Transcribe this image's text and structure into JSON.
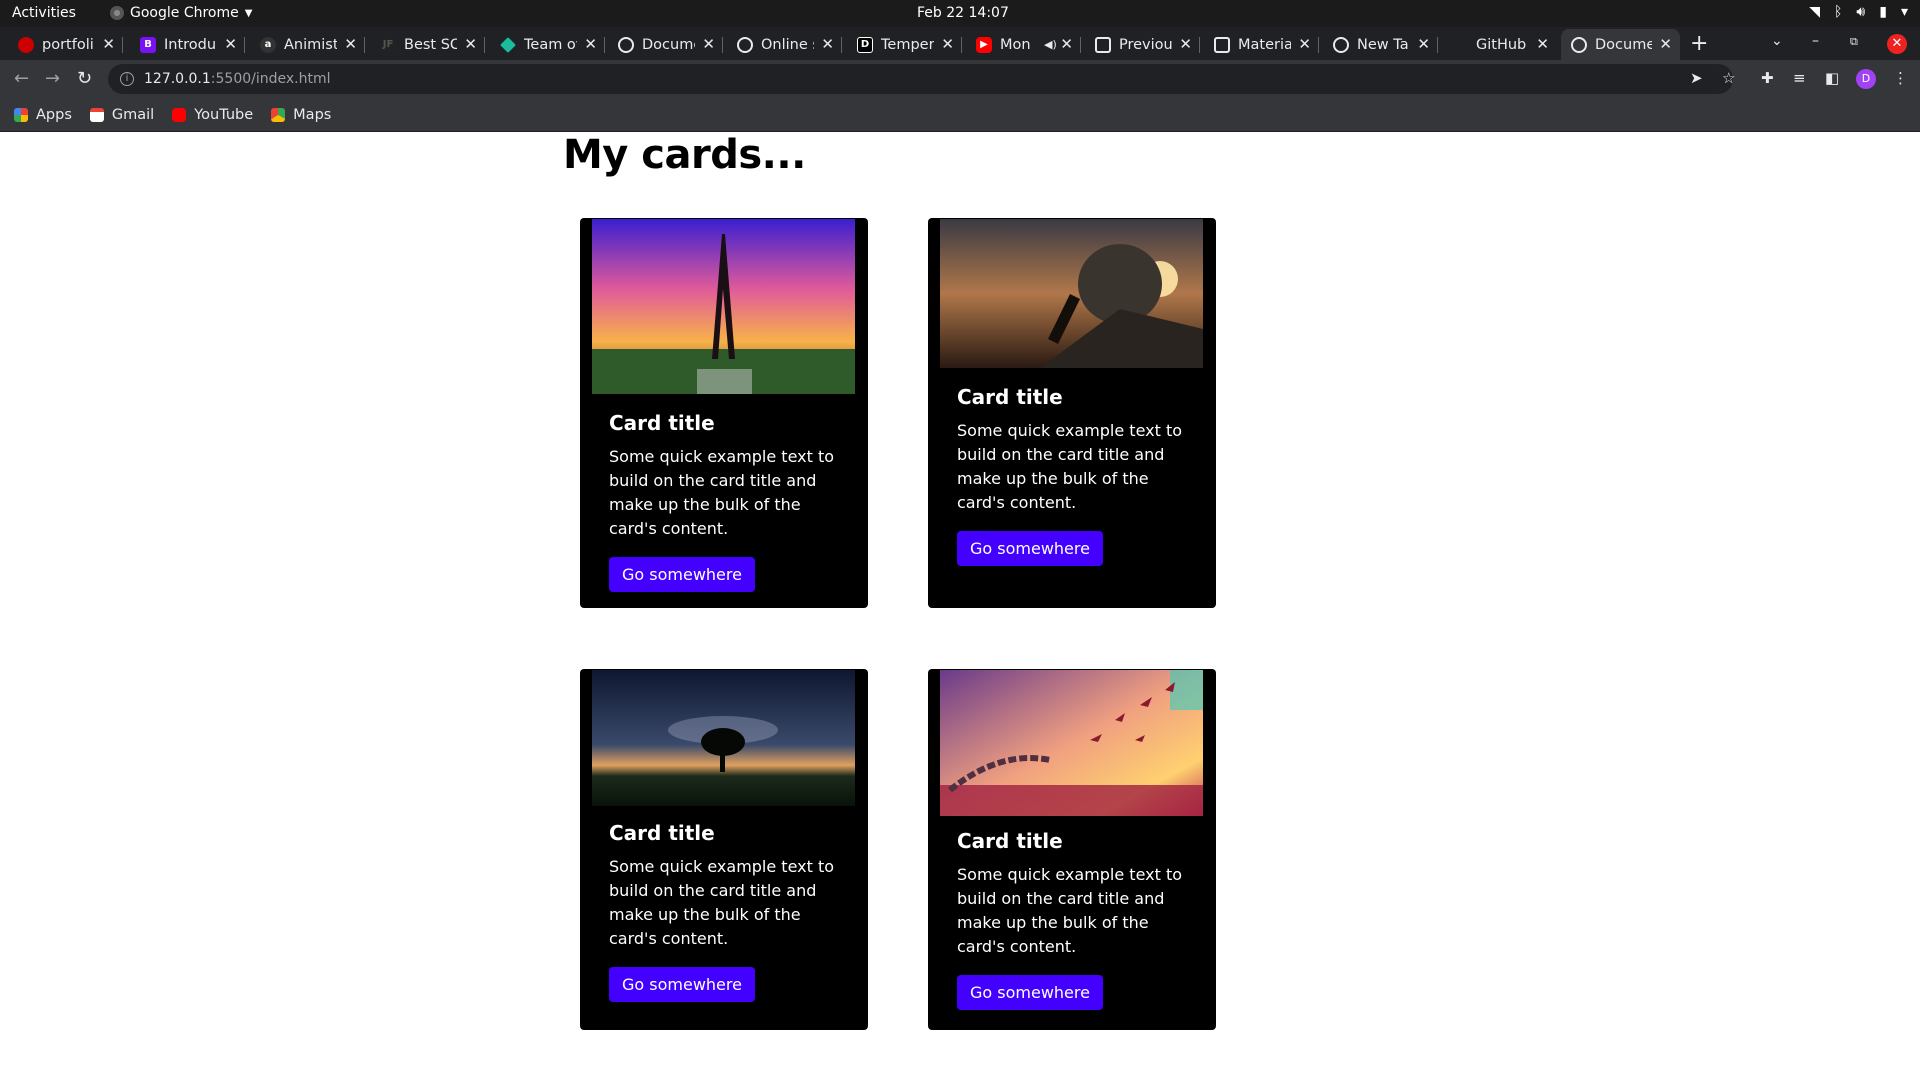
{
  "system_bar": {
    "activities": "Activities",
    "app_name": "Google Chrome",
    "clock": "Feb 22  14:07"
  },
  "tabs": [
    {
      "label": "portfoli",
      "icon": "portfolio-icon",
      "color": "#c00"
    },
    {
      "label": "Introdu",
      "icon": "bootstrap-icon",
      "color": "#7b11f5"
    },
    {
      "label": "Animist",
      "icon": "animista-icon",
      "color": "#333"
    },
    {
      "label": "Best SC",
      "icon": "jf-icon",
      "color": "#222"
    },
    {
      "label": "Team ov",
      "icon": "diamond-icon",
      "color": "#1abc9c"
    },
    {
      "label": "Docume",
      "icon": "globe-icon",
      "color": "#e8eaed"
    },
    {
      "label": "Online s",
      "icon": "globe-icon",
      "color": "#e8eaed"
    },
    {
      "label": "Temper",
      "icon": "dev-icon",
      "color": "#000"
    },
    {
      "label": "Mon",
      "icon": "youtube-icon",
      "color": "#f00"
    },
    {
      "label": "Previou",
      "icon": "codepen-icon",
      "color": "#e8eaed"
    },
    {
      "label": "Materia",
      "icon": "codepen-icon",
      "color": "#e8eaed"
    },
    {
      "label": "New Tal",
      "icon": "chrome-icon",
      "color": "#e8eaed"
    },
    {
      "label": "GitHub",
      "icon": "github-icon",
      "color": "#202124"
    },
    {
      "label": "Docume",
      "icon": "globe-icon",
      "color": "#e8eaed"
    }
  ],
  "address_bar": {
    "host": "127.0.0.1",
    "rest": ":5500/index.html"
  },
  "bookmarks": [
    {
      "label": "Apps",
      "icon": "apps-grid-icon",
      "color": "#4285f4"
    },
    {
      "label": "Gmail",
      "icon": "gmail-icon",
      "color": "#ea4335"
    },
    {
      "label": "YouTube",
      "icon": "youtube-icon",
      "color": "#ff0000"
    },
    {
      "label": "Maps",
      "icon": "maps-icon",
      "color": "#34a853"
    }
  ],
  "page": {
    "heading": "My cards...",
    "cards": [
      {
        "image": "eiffel-tower-image",
        "title": "Card title",
        "text": "Some quick example text to build on the card title and make up the bulk of the card's content.",
        "button": "Go somewhere"
      },
      {
        "image": "boulder-push-image",
        "title": "Card title",
        "text": "Some quick example text to build on the card title and make up the bulk of the card's content.",
        "button": "Go somewhere"
      },
      {
        "image": "night-tree-image",
        "title": "Card title",
        "text": "Some quick example text to build on the card title and make up the bulk of the card's content.",
        "button": "Go somewhere"
      },
      {
        "image": "birds-chain-image",
        "title": "Card title",
        "text": "Some quick example text to build on the card title and make up the bulk of the card's content.",
        "button": "Go somewhere"
      }
    ],
    "button_color": "#4400ff"
  }
}
